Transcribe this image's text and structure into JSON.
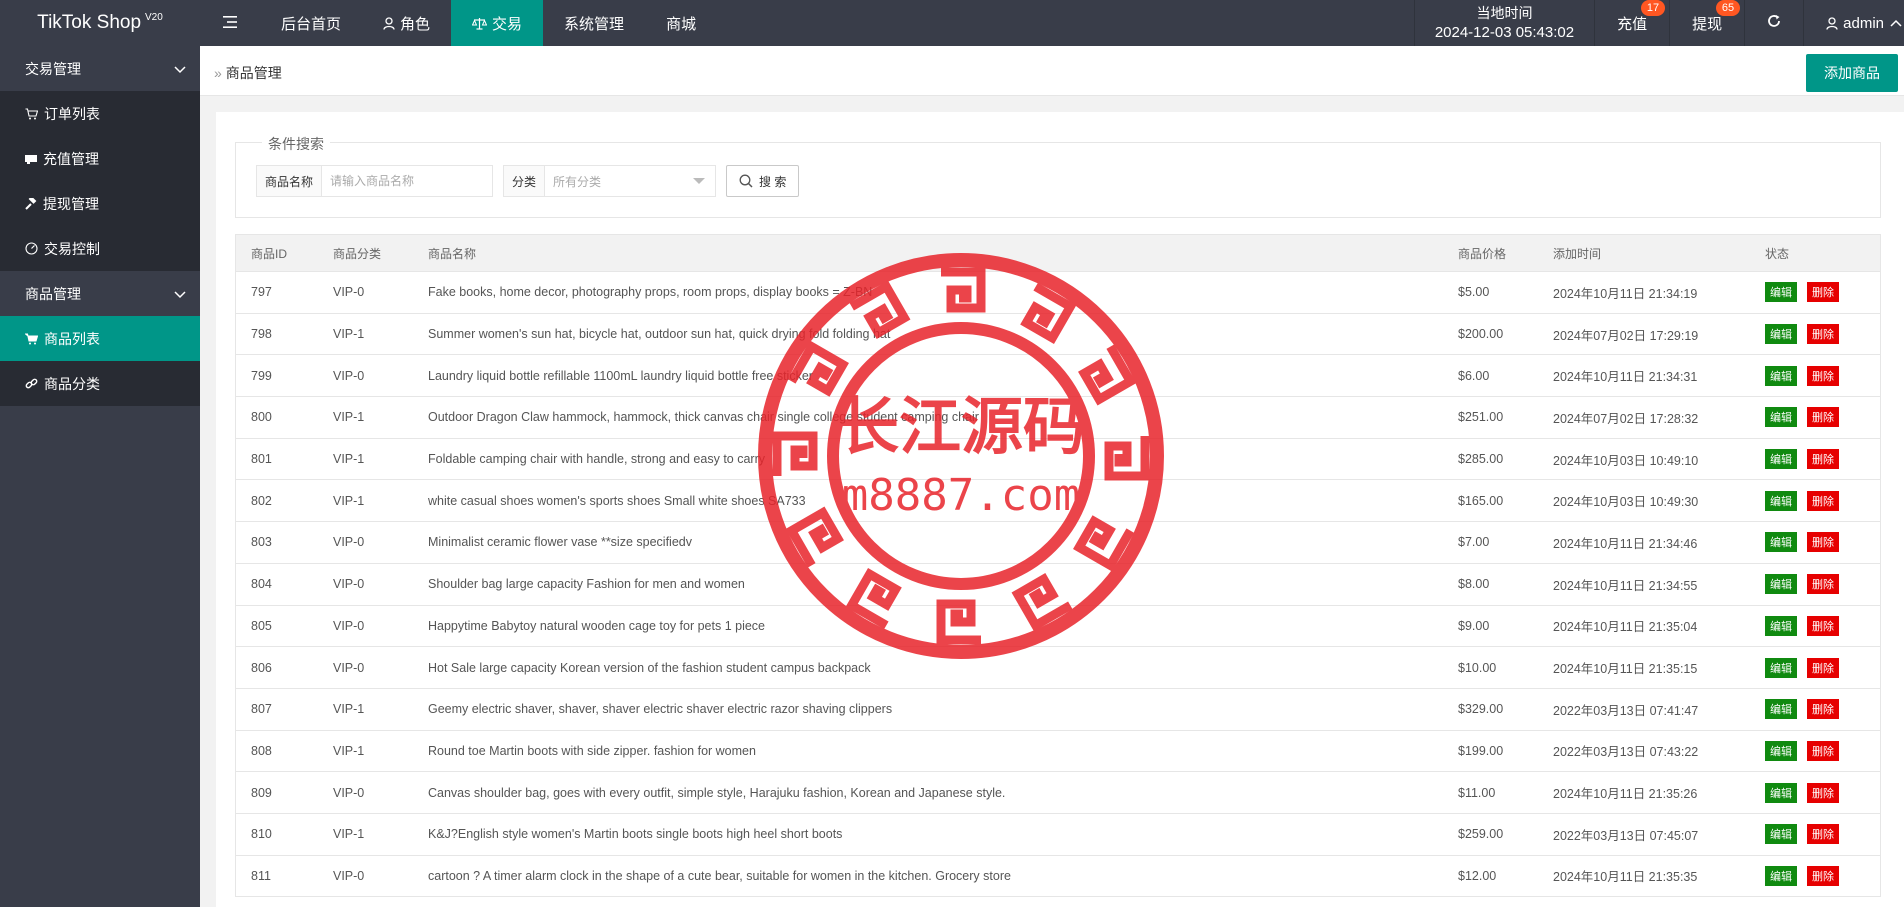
{
  "app": {
    "name": "TikTok Shop",
    "version": "V20"
  },
  "topnav": {
    "items": [
      {
        "label": "后台首页",
        "active": false
      },
      {
        "label": "角色",
        "active": false
      },
      {
        "label": "交易",
        "active": true
      },
      {
        "label": "系统管理",
        "active": false
      },
      {
        "label": "商城",
        "active": false
      }
    ],
    "time_label": "当地时间",
    "time_value": "2024-12-03 05:43:02",
    "recharge_label": "充值",
    "recharge_badge": "17",
    "withdraw_label": "提现",
    "withdraw_badge": "65",
    "user": "admin"
  },
  "sidebar": {
    "groups": [
      {
        "label": "交易管理",
        "items": [
          {
            "label": "订单列表",
            "icon": "cart-icon"
          },
          {
            "label": "充值管理",
            "icon": "card-icon"
          },
          {
            "label": "提现管理",
            "icon": "gavel-icon"
          },
          {
            "label": "交易控制",
            "icon": "dashboard-icon"
          }
        ]
      },
      {
        "label": "商品管理",
        "items": [
          {
            "label": "商品列表",
            "icon": "cart-icon",
            "active": true
          },
          {
            "label": "商品分类",
            "icon": "link-icon"
          }
        ]
      }
    ]
  },
  "breadcrumb": {
    "current": "商品管理"
  },
  "add_button": "添加商品",
  "search": {
    "legend": "条件搜索",
    "name_label": "商品名称",
    "name_placeholder": "请输入商品名称",
    "category_label": "分类",
    "category_value": "所有分类",
    "button": "搜 索"
  },
  "table": {
    "headers": [
      "商品ID",
      "商品分类",
      "商品名称",
      "商品价格",
      "添加时间",
      "状态"
    ],
    "edit_label": "编辑",
    "delete_label": "删除",
    "rows": [
      {
        "id": "797",
        "cat": "VIP-0",
        "name": "Fake books, home decor, photography props, room props, display books = Z-BN",
        "price": "$5.00",
        "time": "2024年10月11日 21:34:19"
      },
      {
        "id": "798",
        "cat": "VIP-1",
        "name": "Summer women's sun hat, bicycle hat, outdoor sun hat, quick drying fold folding hat",
        "price": "$200.00",
        "time": "2024年07月02日 17:29:19"
      },
      {
        "id": "799",
        "cat": "VIP-0",
        "name": "Laundry liquid bottle refillable 1100mL laundry liquid bottle free sticker",
        "price": "$6.00",
        "time": "2024年10月11日 21:34:31"
      },
      {
        "id": "800",
        "cat": "VIP-1",
        "name": "Outdoor Dragon Claw hammock, hammock, thick canvas chair single college student camping chair",
        "price": "$251.00",
        "time": "2024年07月02日 17:28:32"
      },
      {
        "id": "801",
        "cat": "VIP-1",
        "name": "Foldable camping chair with handle, strong and easy to carry",
        "price": "$285.00",
        "time": "2024年10月03日 10:49:10"
      },
      {
        "id": "802",
        "cat": "VIP-1",
        "name": "white casual shoes women's sports shoes Small white shoes SA733",
        "price": "$165.00",
        "time": "2024年10月03日 10:49:30"
      },
      {
        "id": "803",
        "cat": "VIP-0",
        "name": "Minimalist ceramic flower vase **size specifiedv",
        "price": "$7.00",
        "time": "2024年10月11日 21:34:46"
      },
      {
        "id": "804",
        "cat": "VIP-0",
        "name": "Shoulder bag large capacity Fashion for men and women",
        "price": "$8.00",
        "time": "2024年10月11日 21:34:55"
      },
      {
        "id": "805",
        "cat": "VIP-0",
        "name": "Happytime Babytoy natural wooden cage toy for pets 1 piece",
        "price": "$9.00",
        "time": "2024年10月11日 21:35:04"
      },
      {
        "id": "806",
        "cat": "VIP-0",
        "name": "Hot Sale large capacity Korean version of the fashion student campus backpack",
        "price": "$10.00",
        "time": "2024年10月11日 21:35:15"
      },
      {
        "id": "807",
        "cat": "VIP-1",
        "name": "Geemy electric shaver, shaver, shaver electric shaver electric razor shaving clippers",
        "price": "$329.00",
        "time": "2022年03月13日 07:41:47"
      },
      {
        "id": "808",
        "cat": "VIP-1",
        "name": "Round toe Martin boots with side zipper. fashion for women",
        "price": "$199.00",
        "time": "2022年03月13日 07:43:22"
      },
      {
        "id": "809",
        "cat": "VIP-0",
        "name": "Canvas shoulder bag, goes with every outfit, simple style, Harajuku fashion, Korean and Japanese style.",
        "price": "$11.00",
        "time": "2024年10月11日 21:35:26"
      },
      {
        "id": "810",
        "cat": "VIP-1",
        "name": "K&J?English style women's Martin boots single boots high heel short boots",
        "price": "$259.00",
        "time": "2022年03月13日 07:45:07"
      },
      {
        "id": "811",
        "cat": "VIP-0",
        "name": "cartoon ? A timer alarm clock in the shape of a cute bear, suitable for women in the kitchen. Grocery store",
        "price": "$12.00",
        "time": "2024年10月11日 21:35:35"
      }
    ]
  },
  "watermark": {
    "line1": "长江源码",
    "line2": "m8887.com",
    "color": "#e8242b"
  }
}
